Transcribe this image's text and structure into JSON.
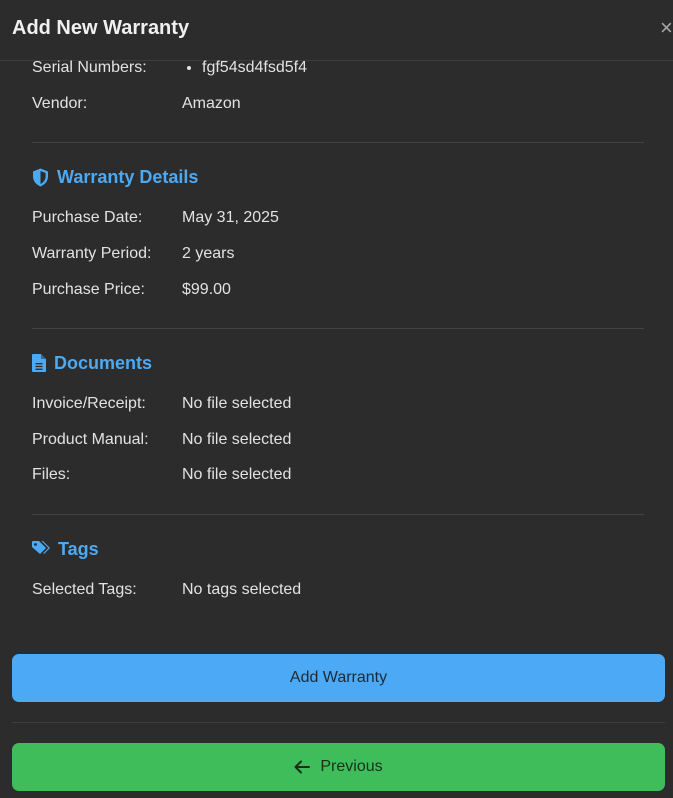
{
  "header": {
    "title": "Add New Warranty",
    "close_symbol": "×"
  },
  "product": {
    "serial_label": "Serial Numbers:",
    "serials": [
      "fgf54sd4fsd5f4"
    ],
    "vendor_label": "Vendor:",
    "vendor": "Amazon"
  },
  "warranty": {
    "title": "Warranty Details",
    "icon": "shield-icon",
    "purchase_date_label": "Purchase Date:",
    "purchase_date": "May 31, 2025",
    "period_label": "Warranty Period:",
    "period": "2 years",
    "price_label": "Purchase Price:",
    "price": "$99.00"
  },
  "documents": {
    "title": "Documents",
    "icon": "file-icon",
    "invoice_label": "Invoice/Receipt:",
    "invoice": "No file selected",
    "manual_label": "Product Manual:",
    "manual": "No file selected",
    "files_label": "Files:",
    "files": "No file selected"
  },
  "tags": {
    "title": "Tags",
    "icon": "tags-icon",
    "selected_label": "Selected Tags:",
    "selected": "No tags selected"
  },
  "actions": {
    "add_label": "Add Warranty",
    "prev_label": "Previous"
  },
  "colors": {
    "accent": "#4ca9f3",
    "add_button": "#4ca9f6",
    "prev_button": "#3fbd5a",
    "background": "#2c2c2c"
  }
}
